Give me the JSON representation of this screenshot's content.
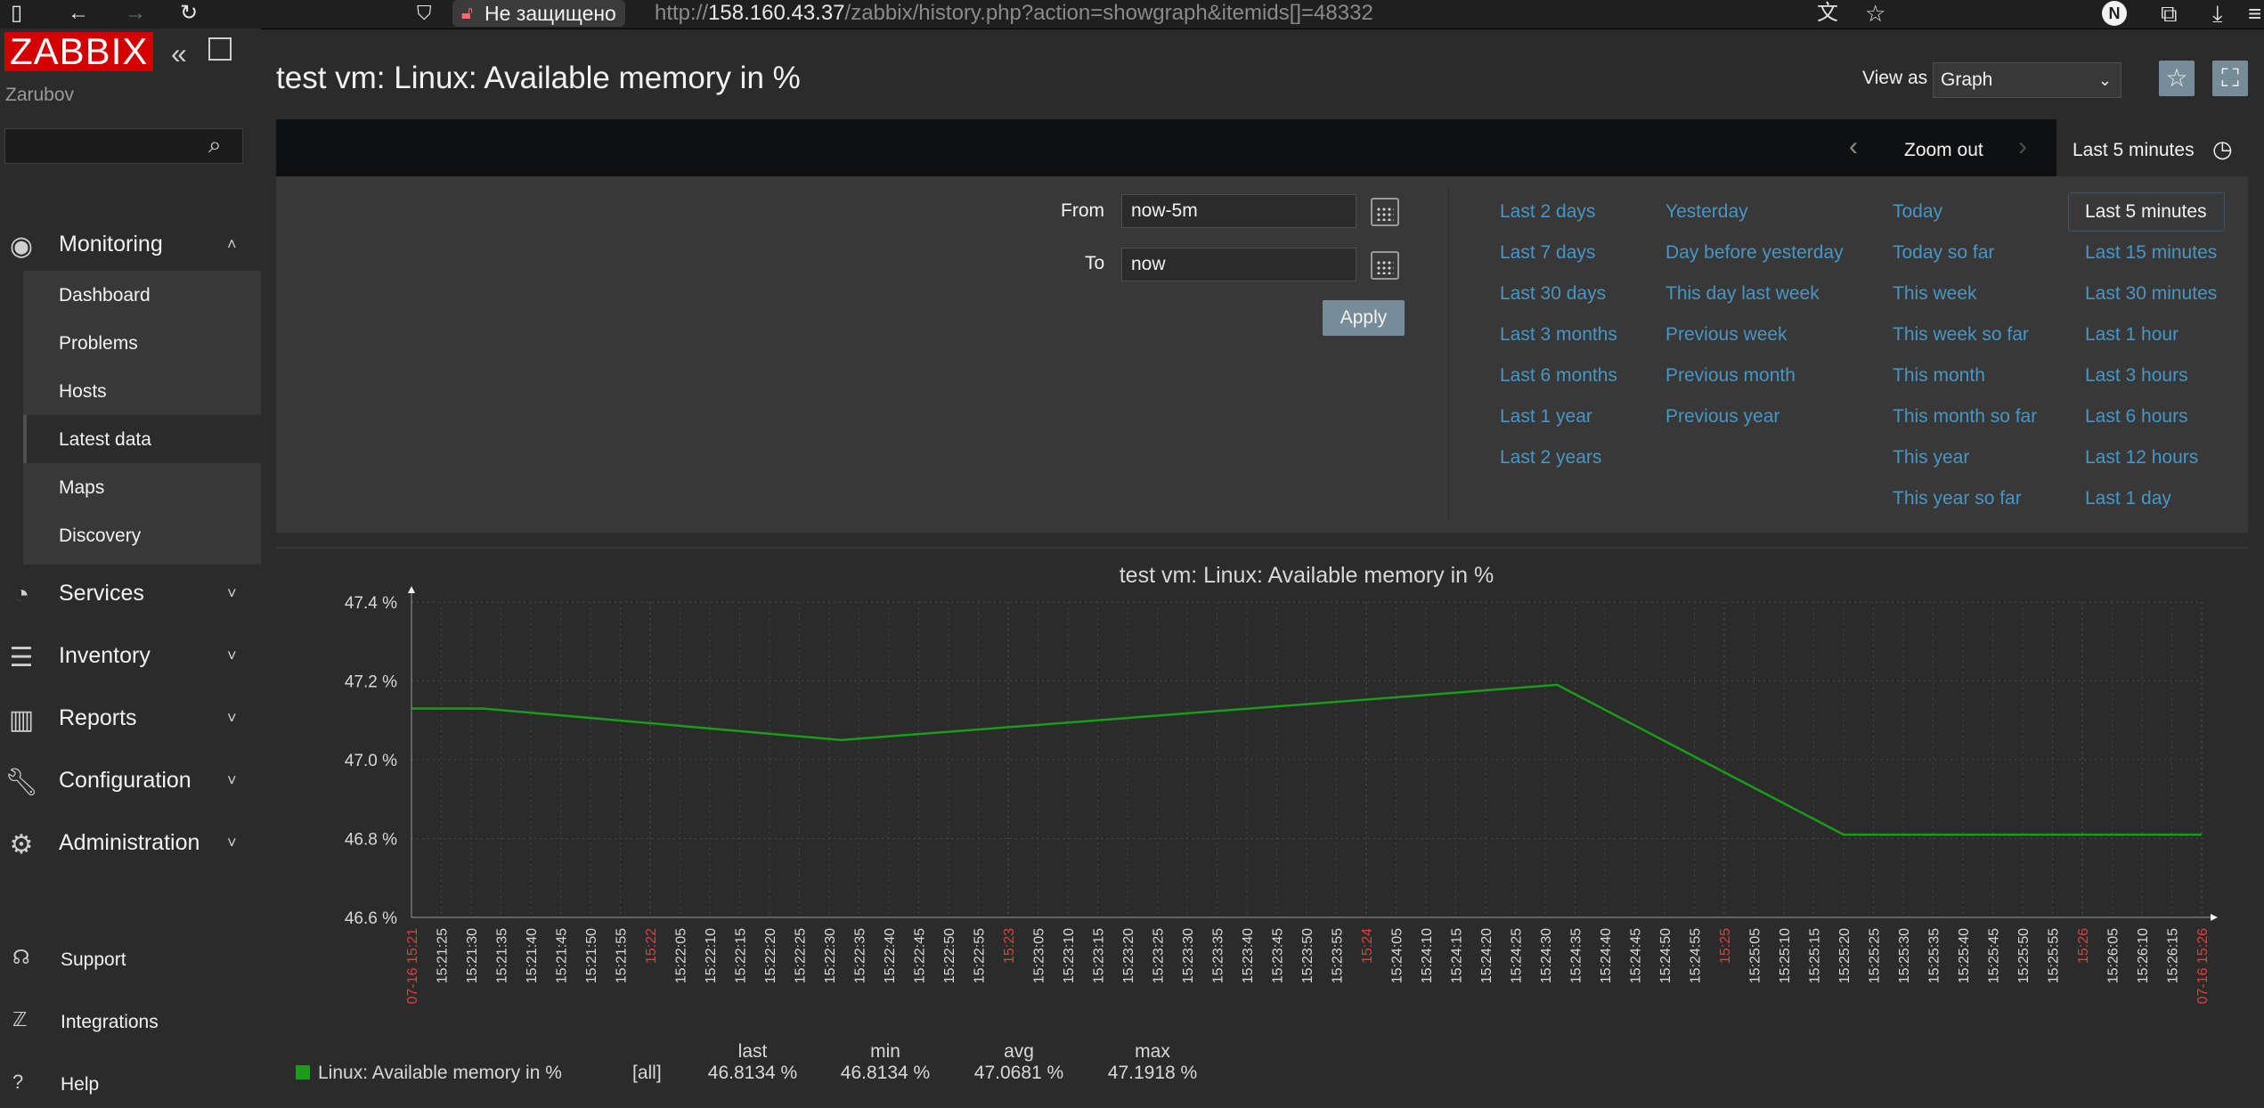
{
  "browser": {
    "security_label": "Не защищено",
    "url_prefix": "http://",
    "url_host": "158.160.43.37",
    "url_path": "/zabbix/history.php?action=showgraph&itemids[]=48332",
    "profile_initial": "N"
  },
  "sidebar": {
    "logo": "ZABBIX",
    "username": "Zarubov",
    "search_value": "",
    "monitoring": {
      "label": "Monitoring",
      "items": [
        "Dashboard",
        "Problems",
        "Hosts",
        "Latest data",
        "Maps",
        "Discovery"
      ],
      "active": "Latest data"
    },
    "sections": [
      "Services",
      "Inventory",
      "Reports",
      "Configuration",
      "Administration"
    ],
    "bottom": [
      "Support",
      "Integrations",
      "Help"
    ]
  },
  "header": {
    "title": "test vm: Linux: Available memory in %",
    "view_as_label": "View as",
    "view_as_value": "Graph"
  },
  "filter": {
    "zoom_out": "Zoom out",
    "time_tab": "Last 5 minutes",
    "from_label": "From",
    "from_value": "now-5m",
    "to_label": "To",
    "to_value": "now",
    "apply": "Apply",
    "quick_ranges": [
      [
        "Last 2 days",
        "Last 7 days",
        "Last 30 days",
        "Last 3 months",
        "Last 6 months",
        "Last 1 year",
        "Last 2 years"
      ],
      [
        "Yesterday",
        "Day before yesterday",
        "This day last week",
        "Previous week",
        "Previous month",
        "Previous year"
      ],
      [
        "Today",
        "Today so far",
        "This week",
        "This week so far",
        "This month",
        "This month so far",
        "This year",
        "This year so far"
      ],
      [
        "Last 5 minutes",
        "Last 15 minutes",
        "Last 30 minutes",
        "Last 1 hour",
        "Last 3 hours",
        "Last 6 hours",
        "Last 12 hours",
        "Last 1 day"
      ]
    ],
    "selected_range": "Last 5 minutes"
  },
  "colors": {
    "accent": "#d40000",
    "link": "#4796c4",
    "series": "#1a9c1a",
    "tick_red": "#dc4040",
    "button": "#768d99"
  },
  "chart_data": {
    "type": "line",
    "title": "test vm: Linux: Available memory in %",
    "ylim": [
      46.6,
      47.4
    ],
    "y_ticks": [
      "47.4 %",
      "47.2 %",
      "47.0 %",
      "46.8 %",
      "46.6 %"
    ],
    "x_ticks": [
      "07-16 15:21",
      "15:21:25",
      "15:21:30",
      "15:21:35",
      "15:21:40",
      "15:21:45",
      "15:21:50",
      "15:21:55",
      "15:22",
      "15:22:05",
      "15:22:10",
      "15:22:15",
      "15:22:20",
      "15:22:25",
      "15:22:30",
      "15:22:35",
      "15:22:40",
      "15:22:45",
      "15:22:50",
      "15:22:55",
      "15:23",
      "15:23:05",
      "15:23:10",
      "15:23:15",
      "15:23:20",
      "15:23:25",
      "15:23:30",
      "15:23:35",
      "15:23:40",
      "15:23:45",
      "15:23:50",
      "15:23:55",
      "15:24",
      "15:24:05",
      "15:24:10",
      "15:24:15",
      "15:24:20",
      "15:24:25",
      "15:24:30",
      "15:24:35",
      "15:24:40",
      "15:24:45",
      "15:24:50",
      "15:24:55",
      "15:25",
      "15:25:05",
      "15:25:10",
      "15:25:15",
      "15:25:20",
      "15:25:25",
      "15:25:30",
      "15:25:35",
      "15:25:40",
      "15:25:45",
      "15:25:50",
      "15:25:55",
      "15:26",
      "15:26:05",
      "15:26:10",
      "15:26:15",
      "07-16 15:26"
    ],
    "x_tick_red": [
      "07-16 15:21",
      "15:22",
      "15:23",
      "15:24",
      "15:25",
      "15:26",
      "07-16 15:26"
    ],
    "x_seconds_range": [
      0,
      300
    ],
    "series": [
      {
        "name": "Linux: Available memory in %",
        "x_seconds": [
          0,
          12,
          72,
          192,
          240,
          300
        ],
        "values": [
          47.13,
          47.13,
          47.05,
          47.19,
          46.81,
          46.81
        ]
      }
    ],
    "legend": {
      "label": "Linux: Available memory in %",
      "func": "[all]",
      "headers": [
        "last",
        "min",
        "avg",
        "max"
      ],
      "values": [
        "46.8134 %",
        "46.8134 %",
        "47.0681 %",
        "47.1918 %"
      ]
    }
  }
}
